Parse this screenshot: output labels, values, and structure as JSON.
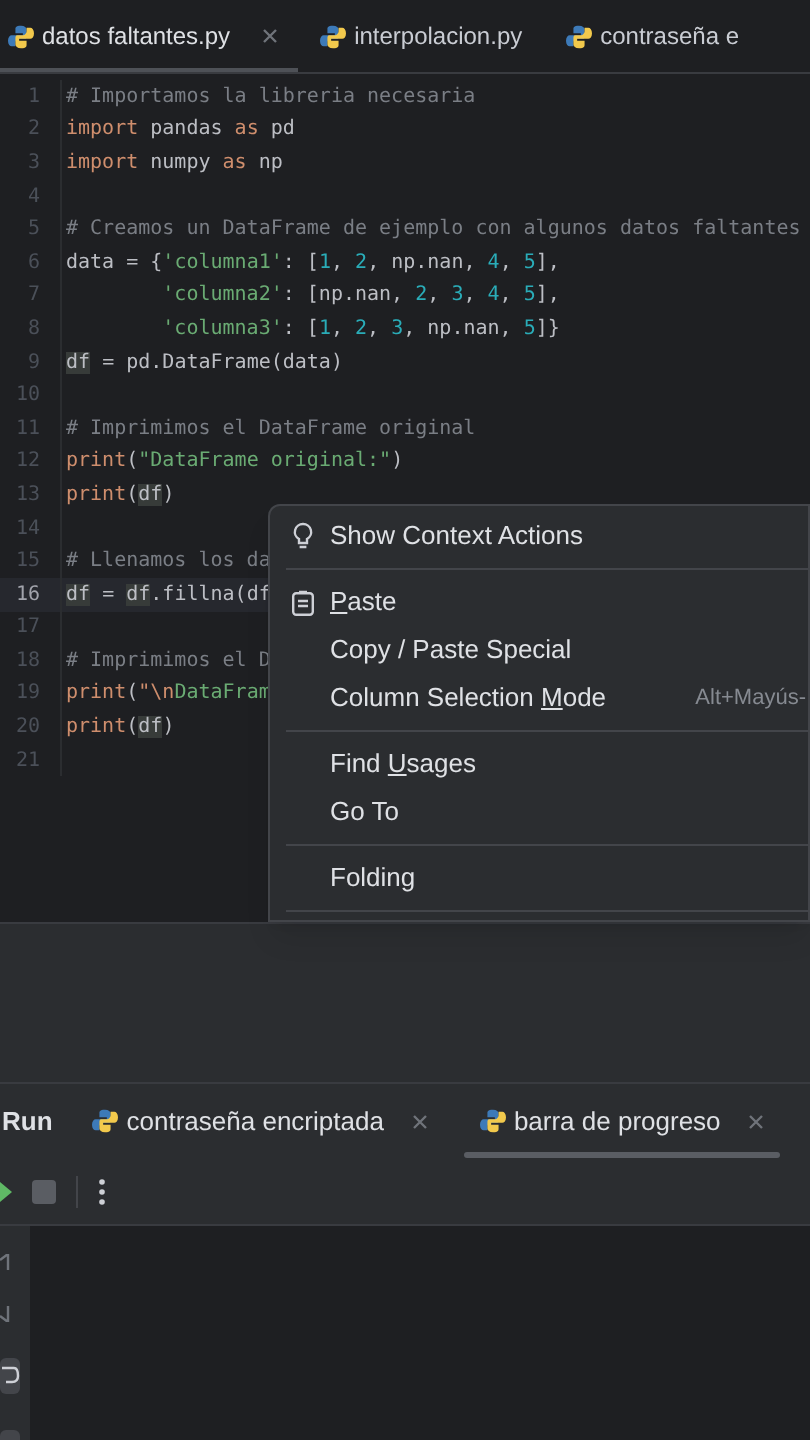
{
  "editor_tabs": [
    {
      "label": "datos faltantes.py",
      "selected": true,
      "closable": true
    },
    {
      "label": "interpolacion.py",
      "selected": false,
      "closable": false
    },
    {
      "label": "contraseña e",
      "selected": false,
      "closable": false
    }
  ],
  "code_lines": [
    {
      "number": "1",
      "current": false,
      "tokens": [
        {
          "kind": "comment",
          "text": "# Importamos la libreria necesaria"
        }
      ]
    },
    {
      "number": "2",
      "current": false,
      "tokens": [
        {
          "kind": "keyword",
          "text": "import"
        },
        {
          "kind": "plain",
          "text": " pandas "
        },
        {
          "kind": "keyword",
          "text": "as"
        },
        {
          "kind": "plain",
          "text": " pd"
        }
      ]
    },
    {
      "number": "3",
      "current": false,
      "tokens": [
        {
          "kind": "keyword",
          "text": "import"
        },
        {
          "kind": "plain",
          "text": " numpy "
        },
        {
          "kind": "keyword",
          "text": "as"
        },
        {
          "kind": "plain",
          "text": " np"
        }
      ]
    },
    {
      "number": "4",
      "current": false
    },
    {
      "number": "5",
      "current": false,
      "tokens": [
        {
          "kind": "comment",
          "text": "# Creamos un DataFrame de ejemplo con algunos datos faltantes"
        }
      ]
    },
    {
      "number": "6",
      "current": false,
      "tokens": [
        {
          "kind": "plain",
          "text": "data = {"
        },
        {
          "kind": "string",
          "text": "'columna1'"
        },
        {
          "kind": "plain",
          "text": ": ["
        },
        {
          "kind": "number",
          "text": "1"
        },
        {
          "kind": "plain",
          "text": ", "
        },
        {
          "kind": "number",
          "text": "2"
        },
        {
          "kind": "plain",
          "text": ", np.nan, "
        },
        {
          "kind": "number",
          "text": "4"
        },
        {
          "kind": "plain",
          "text": ", "
        },
        {
          "kind": "number",
          "text": "5"
        },
        {
          "kind": "plain",
          "text": "],"
        }
      ]
    },
    {
      "number": "7",
      "current": false,
      "tokens": [
        {
          "kind": "string",
          "text": "        'columna2'"
        },
        {
          "kind": "plain",
          "text": ": [np.nan, "
        },
        {
          "kind": "number",
          "text": "2"
        },
        {
          "kind": "plain",
          "text": ", "
        },
        {
          "kind": "number",
          "text": "3"
        },
        {
          "kind": "plain",
          "text": ", "
        },
        {
          "kind": "number",
          "text": "4"
        },
        {
          "kind": "plain",
          "text": ", "
        },
        {
          "kind": "number",
          "text": "5"
        },
        {
          "kind": "plain",
          "text": "],"
        }
      ]
    },
    {
      "number": "8",
      "current": false,
      "tokens": [
        {
          "kind": "string",
          "text": "        'columna3'"
        },
        {
          "kind": "plain",
          "text": ": ["
        },
        {
          "kind": "number",
          "text": "1"
        },
        {
          "kind": "plain",
          "text": ", "
        },
        {
          "kind": "number",
          "text": "2"
        },
        {
          "kind": "plain",
          "text": ", "
        },
        {
          "kind": "number",
          "text": "3"
        },
        {
          "kind": "plain",
          "text": ", np.nan, "
        },
        {
          "kind": "number",
          "text": "5"
        },
        {
          "kind": "plain",
          "text": "]}"
        }
      ]
    },
    {
      "number": "9",
      "current": false,
      "tokens": [
        {
          "kind": "ref",
          "text": "df"
        },
        {
          "kind": "plain",
          "text": " = pd.DataFrame(data)"
        }
      ]
    },
    {
      "number": "10",
      "current": false
    },
    {
      "number": "11",
      "current": false,
      "tokens": [
        {
          "kind": "comment",
          "text": "# Imprimimos el DataFrame original"
        }
      ]
    },
    {
      "number": "12",
      "current": false,
      "tokens": [
        {
          "kind": "keyword",
          "text": "print"
        },
        {
          "kind": "plain",
          "text": "("
        },
        {
          "kind": "string",
          "text": "\"DataFrame original:\""
        },
        {
          "kind": "plain",
          "text": ")"
        }
      ]
    },
    {
      "number": "13",
      "current": false,
      "tokens": [
        {
          "kind": "keyword",
          "text": "print"
        },
        {
          "kind": "plain",
          "text": "("
        },
        {
          "kind": "ref",
          "text": "df"
        },
        {
          "kind": "plain",
          "text": ")"
        }
      ]
    },
    {
      "number": "14",
      "current": false
    },
    {
      "number": "15",
      "current": false,
      "tokens": [
        {
          "kind": "comment",
          "text": "# Llenamos los da"
        }
      ]
    },
    {
      "number": "16",
      "current": true,
      "tokens": [
        {
          "kind": "ref",
          "text": "df"
        },
        {
          "kind": "plain",
          "text": " = "
        },
        {
          "kind": "ref",
          "text": "df"
        },
        {
          "kind": "plain",
          "text": ".fillna(df"
        }
      ]
    },
    {
      "number": "17",
      "current": false
    },
    {
      "number": "18",
      "current": false,
      "tokens": [
        {
          "kind": "comment",
          "text": "# Imprimimos el D"
        }
      ]
    },
    {
      "number": "19",
      "current": false,
      "tokens": [
        {
          "kind": "keyword",
          "text": "print"
        },
        {
          "kind": "plain",
          "text": "("
        },
        {
          "kind": "escape",
          "text": "\"\\n"
        },
        {
          "kind": "string",
          "text": "DataFram"
        }
      ]
    },
    {
      "number": "20",
      "current": false,
      "tokens": [
        {
          "kind": "keyword",
          "text": "print"
        },
        {
          "kind": "plain",
          "text": "("
        },
        {
          "kind": "ref",
          "text": "df"
        },
        {
          "kind": "plain",
          "text": ")"
        }
      ]
    },
    {
      "number": "21",
      "current": false
    }
  ],
  "context_menu": [
    {
      "kind": "hint",
      "pre": "Show Context Actions"
    },
    {
      "kind": "separator"
    },
    {
      "kind": "paste",
      "key": "P",
      "post": "aste"
    },
    {
      "kind": "item",
      "pre": "Copy / Paste Special"
    },
    {
      "kind": "item",
      "pre": "Column Selection ",
      "key": "M",
      "post": "ode",
      "shortcut": "Alt+Mayús-"
    },
    {
      "kind": "separator"
    },
    {
      "kind": "item",
      "pre": "Find ",
      "key": "U",
      "post": "sages"
    },
    {
      "kind": "item",
      "pre": "Go To"
    },
    {
      "kind": "separator"
    },
    {
      "kind": "item",
      "pre": "Folding"
    },
    {
      "kind": "separator"
    }
  ],
  "run_panel": {
    "title": "Run",
    "tabs": [
      {
        "label": "contraseña encriptada",
        "selected": false
      },
      {
        "label": "barra de progreso",
        "selected": true
      }
    ]
  }
}
